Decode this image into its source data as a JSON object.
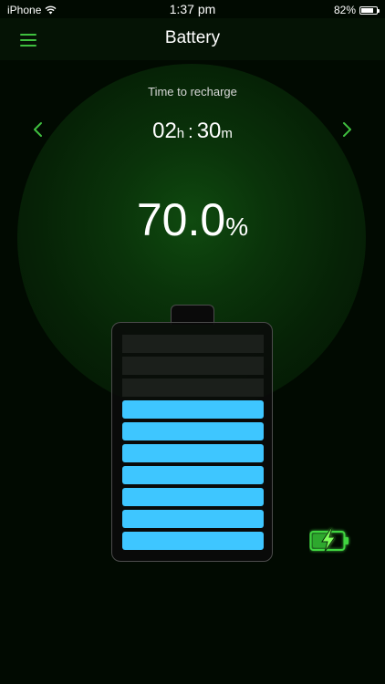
{
  "status_bar": {
    "carrier": "iPhone",
    "time": "1:37 pm",
    "battery_percent": "82%",
    "battery_level": 0.82
  },
  "nav": {
    "title": "Battery",
    "menu_icon": "hamburger-menu-icon"
  },
  "main": {
    "recharge_label": "Time to recharge",
    "hours": "02",
    "hours_unit": "h",
    "separator": ":",
    "minutes": "30",
    "minutes_unit": "m",
    "percent_value": "70.0",
    "percent_sign": "%",
    "left_arrow_icon": "chevron-left-icon",
    "right_arrow_icon": "chevron-right-icon"
  },
  "battery": {
    "total_cells": 10,
    "filled_cells": 7,
    "fill_color": "#3ec6ff",
    "empty_color": "#1b1f1b",
    "charging_icon": "charging-battery-icon"
  },
  "colors": {
    "accent": "#3fbf3f",
    "background": "#010a01"
  }
}
